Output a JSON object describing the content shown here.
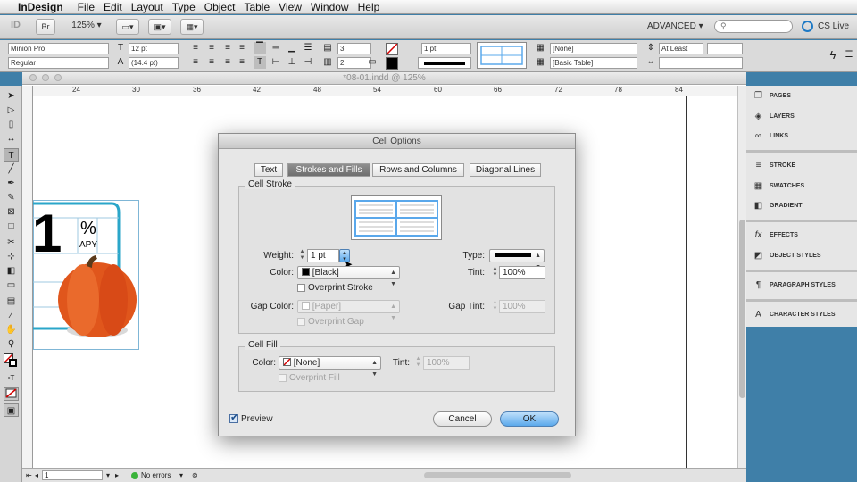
{
  "menubar": {
    "app": "InDesign",
    "items": [
      "File",
      "Edit",
      "Layout",
      "Type",
      "Object",
      "Table",
      "View",
      "Window",
      "Help"
    ]
  },
  "appbar": {
    "logo": "ID",
    "br": "Br",
    "zoom": "125%",
    "workspace": "ADVANCED ▾",
    "cs_live": "CS Live"
  },
  "control": {
    "font_family": "Minion Pro",
    "font_style": "Regular",
    "font_size": "12 pt",
    "leading": "(14.4 pt)",
    "rows": "3",
    "cols": "2",
    "stroke_weight": "1 pt",
    "cell_style": "[None]",
    "table_style": "[Basic Table]",
    "row_height": "At Least"
  },
  "document": {
    "title": "*08-01.indd @ 125%",
    "ruler_ticks": [
      "24",
      "30",
      "36",
      "42",
      "48",
      "54",
      "60",
      "66",
      "72",
      "78",
      "84"
    ],
    "page_number": "1",
    "preflight": "No errors",
    "artwork_text_big": "1",
    "artwork_text_pct": "%",
    "artwork_text_apy": "APY"
  },
  "panels": [
    {
      "label": "PAGES",
      "icon": "pages-icon"
    },
    {
      "label": "LAYERS",
      "icon": "layers-icon"
    },
    {
      "label": "LINKS",
      "icon": "links-icon"
    },
    {
      "label": "STROKE",
      "icon": "stroke-icon"
    },
    {
      "label": "SWATCHES",
      "icon": "swatches-icon"
    },
    {
      "label": "GRADIENT",
      "icon": "gradient-icon"
    },
    {
      "label": "EFFECTS",
      "icon": "effects-icon"
    },
    {
      "label": "OBJECT STYLES",
      "icon": "object-styles-icon"
    },
    {
      "label": "PARAGRAPH STYLES",
      "icon": "paragraph-styles-icon"
    },
    {
      "label": "CHARACTER STYLES",
      "icon": "character-styles-icon"
    }
  ],
  "dialog": {
    "title": "Cell Options",
    "tabs": [
      "Text",
      "Strokes and Fills",
      "Rows and Columns",
      "Diagonal Lines"
    ],
    "selected_tab": "Strokes and Fills",
    "cell_stroke": {
      "group_label": "Cell Stroke",
      "weight_label": "Weight:",
      "weight_value": "1 pt",
      "type_label": "Type:",
      "color_label": "Color:",
      "color_value": "[Black]",
      "tint_label": "Tint:",
      "tint_value": "100%",
      "overprint_stroke": "Overprint Stroke",
      "gap_color_label": "Gap Color:",
      "gap_color_value": "[Paper]",
      "gap_tint_label": "Gap Tint:",
      "gap_tint_value": "100%",
      "overprint_gap": "Overprint Gap"
    },
    "cell_fill": {
      "group_label": "Cell Fill",
      "color_label": "Color:",
      "color_value": "[None]",
      "tint_label": "Tint:",
      "tint_value": "100%",
      "overprint_fill": "Overprint Fill"
    },
    "preview_label": "Preview",
    "preview_checked": true,
    "cancel_label": "Cancel",
    "ok_label": "OK"
  },
  "colors": {
    "accent": "#5aa8eb",
    "pasteboard": "#3f7fa8",
    "frame": "#2aa6c9",
    "pumpkin": "#e0561c"
  }
}
